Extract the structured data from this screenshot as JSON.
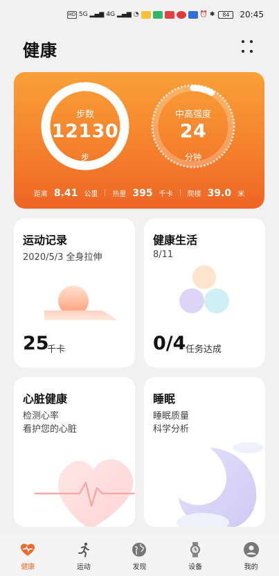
{
  "status_bar": {
    "sim1": "HD",
    "sim2": "HD",
    "signal1": "5G",
    "signal2": "4G",
    "battery": "84",
    "time": "20:45"
  },
  "header": {
    "title": "健康"
  },
  "summary": {
    "steps_label": "步数",
    "steps_value": "12130",
    "steps_unit": "步",
    "steps_progress": 0.98,
    "intensity_label": "中高强度",
    "intensity_value": "24",
    "intensity_unit": "分钟",
    "intensity_progress": 0.08,
    "distance_label": "距离",
    "distance_value": "8.41",
    "distance_unit": "公里",
    "calories_label": "热量",
    "calories_value": "395",
    "calories_unit": "千卡",
    "climb_label": "爬楼",
    "climb_value": "39.0",
    "climb_unit": "米"
  },
  "cards": {
    "exercise": {
      "title": "运动记录",
      "subtitle": "2020/5/3 全身拉伸",
      "value": "25",
      "unit": "千卡"
    },
    "healthy_life": {
      "title": "健康生活",
      "subtitle": "8/11",
      "value": "0/4",
      "unit": "任务达成"
    },
    "heart": {
      "title": "心脏健康",
      "line1": "检测心率",
      "line2": "看护您的心脏"
    },
    "sleep": {
      "title": "睡眠",
      "line1": "睡眠质量",
      "line2": "科学分析"
    }
  },
  "nav": {
    "items": [
      {
        "label": "健康",
        "icon": "heart-pulse-icon"
      },
      {
        "label": "运动",
        "icon": "running-icon"
      },
      {
        "label": "发现",
        "icon": "globe-icon"
      },
      {
        "label": "设备",
        "icon": "watch-icon"
      },
      {
        "label": "我的",
        "icon": "user-icon"
      }
    ]
  },
  "colors": {
    "accent": "#ef6a2d",
    "summary_top": "#f9a038",
    "summary_bottom": "#ee6525"
  }
}
